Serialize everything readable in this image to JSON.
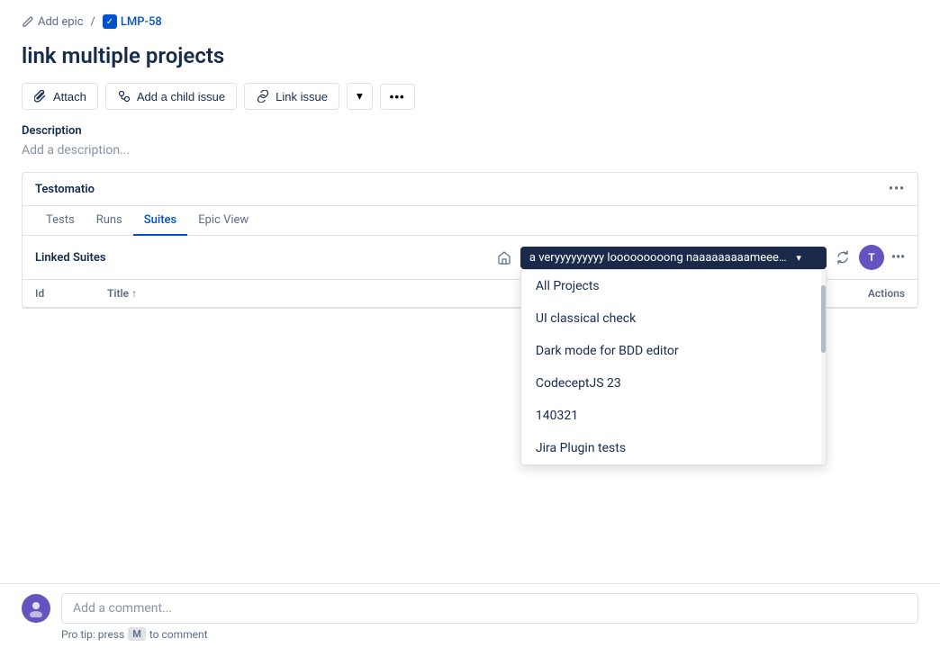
{
  "breadcrumb": {
    "add_epic_label": "Add epic",
    "separator": "/",
    "issue_id": "LMP-58"
  },
  "page": {
    "title": "link multiple projects"
  },
  "toolbar": {
    "attach_label": "Attach",
    "add_child_label": "Add a child issue",
    "link_issue_label": "Link issue",
    "dropdown_arrow": "▾",
    "more_label": "•••"
  },
  "description": {
    "section_title": "Description",
    "placeholder": "Add a description..."
  },
  "testomatio": {
    "title": "Testomatio",
    "more_label": "•••",
    "tabs": [
      {
        "id": "tests",
        "label": "Tests"
      },
      {
        "id": "runs",
        "label": "Runs"
      },
      {
        "id": "suites",
        "label": "Suites",
        "active": true
      },
      {
        "id": "epic_view",
        "label": "Epic View"
      }
    ],
    "linked_suites": {
      "title": "Linked Suites",
      "selected_project": "a veryyyyyyyyy looooooooong naaaaaaaaameeeeeee",
      "dropdown_arrow": "▾",
      "table": {
        "col_id": "Id",
        "col_title": "Title ↑",
        "col_actions": "Actions"
      },
      "dropdown_items": [
        {
          "id": "all_projects",
          "label": "All Projects"
        },
        {
          "id": "ui_classical",
          "label": "UI classical check"
        },
        {
          "id": "dark_mode",
          "label": "Dark mode for BDD editor"
        },
        {
          "id": "codeceptjs",
          "label": "CodeceptJS 23"
        },
        {
          "id": "item_140321",
          "label": "140321"
        },
        {
          "id": "jira_plugin",
          "label": "Jira Plugin tests"
        }
      ]
    }
  },
  "comment": {
    "placeholder": "Add a comment...",
    "avatar_initials": "",
    "pro_tip": "Pro tip: press",
    "key_label": "M",
    "pro_tip_suffix": "to comment"
  },
  "icons": {
    "pencil": "✏",
    "paperclip": "🔗",
    "child_issue": "⑃",
    "link": "🔗",
    "home": "⌂",
    "sync": "⇄",
    "avatar_t": "T"
  }
}
